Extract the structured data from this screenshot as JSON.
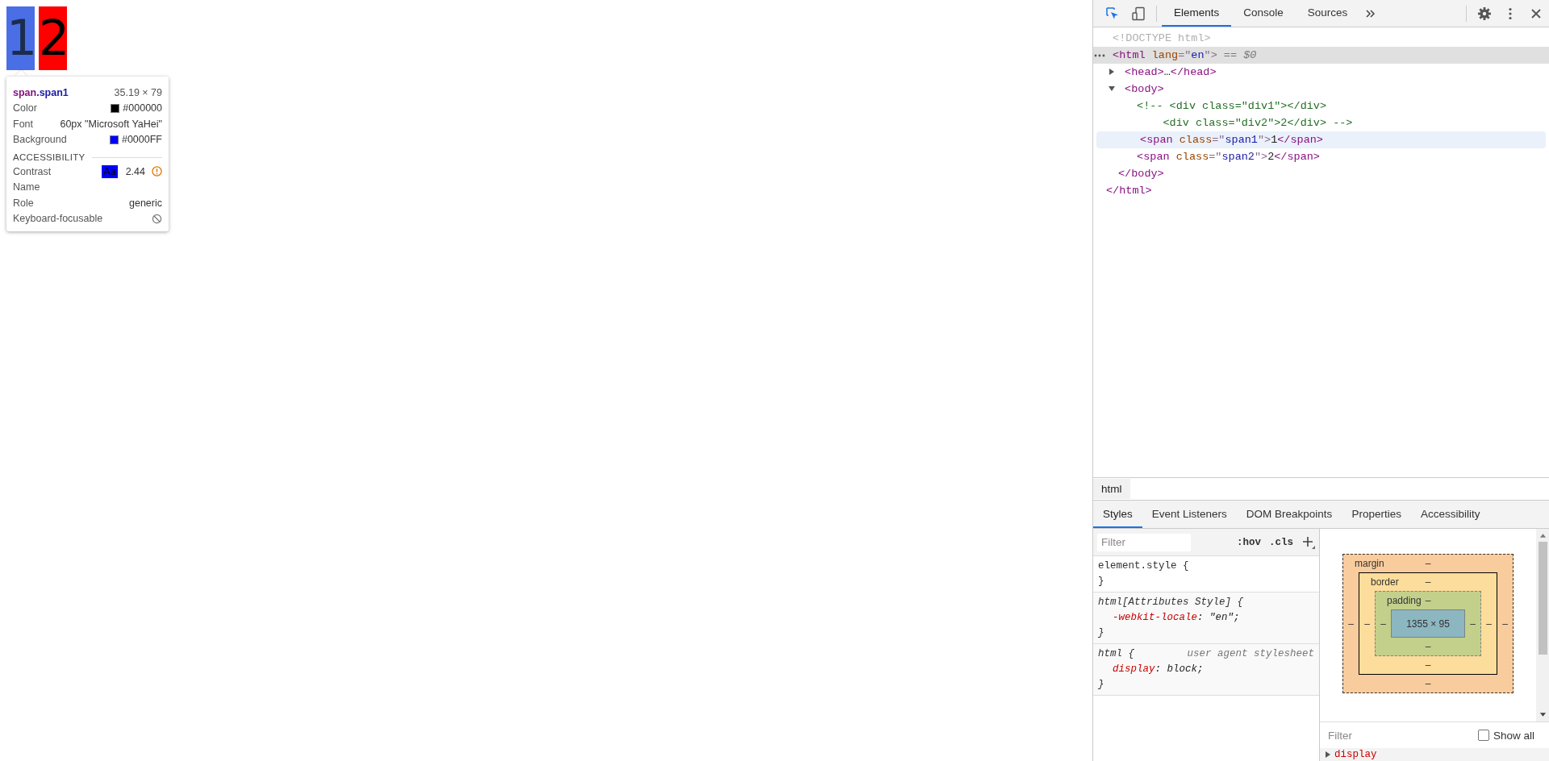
{
  "page": {
    "spans": [
      {
        "text": "1",
        "color": "#4a6ee6",
        "highlighted": true
      },
      {
        "text": "2",
        "color": "#ff0000",
        "highlighted": false
      }
    ]
  },
  "tooltip": {
    "tag": "span",
    "class_name": ".span1",
    "size": "35.19 × 79",
    "rows": [
      {
        "label": "Color",
        "value": "#000000",
        "color": "#000000"
      },
      {
        "label": "Font",
        "value": "60px \"Microsoft YaHei\""
      },
      {
        "label": "Background",
        "value": "#0000FF",
        "color": "#0000ff"
      }
    ],
    "section": "ACCESSIBILITY",
    "contrast": {
      "label": "Contrast",
      "sample": "Aa",
      "ratio": "2.44"
    },
    "a11y_rows": [
      {
        "label": "Name"
      },
      {
        "label": "Role",
        "value": "generic"
      },
      {
        "label": "Keyboard-focusable",
        "kind": "blocked"
      }
    ]
  },
  "devtools": {
    "tabs": [
      {
        "label": "Elements",
        "selected": true
      },
      {
        "label": "Console",
        "selected": false
      },
      {
        "label": "Sources",
        "selected": false
      }
    ],
    "dom": [
      {
        "lines": [
          [
            {
              "kind": "doctype",
              "text": "<!DOCTYPE html>"
            }
          ]
        ],
        "selected": false,
        "hovered": false
      },
      {
        "lines": [
          [
            {
              "kind": "tag",
              "text": "<html"
            },
            {
              "kind": "attr",
              "text": " lang"
            },
            {
              "kind": "punct",
              "text": "=\""
            },
            {
              "kind": "value",
              "text": "en"
            },
            {
              "kind": "punct",
              "text": "\">"
            },
            {
              "kind": "marker",
              "text": " == $0"
            }
          ]
        ],
        "selected": true,
        "hovered": false,
        "children": [
          {
            "lines": [
              [
                {
                  "kind": "tag",
                  "text": "<head>"
                },
                {
                  "kind": "text",
                  "text": "…"
                },
                {
                  "kind": "tag",
                  "text": "</head>"
                }
              ]
            ],
            "selected": false,
            "hovered": false,
            "expanded": false
          },
          {
            "lines": [
              [
                {
                  "kind": "tag",
                  "text": "<body>"
                }
              ]
            ],
            "selected": false,
            "hovered": false,
            "expanded": true,
            "children": [
              {
                "lines": [
                  [
                    {
                      "kind": "comment",
                      "text": "<!-- <div class=\"div1\"></div>"
                    }
                  ],
                  [
                    {
                      "kind": "comment",
                      "text": "    <div class=\"div2\">2</div> -->"
                    }
                  ]
                ],
                "selected": false,
                "hovered": false
              },
              {
                "lines": [
                  [
                    {
                      "kind": "tag",
                      "text": "<span"
                    },
                    {
                      "kind": "attr",
                      "text": " class"
                    },
                    {
                      "kind": "punct",
                      "text": "=\""
                    },
                    {
                      "kind": "value",
                      "text": "span1"
                    },
                    {
                      "kind": "punct",
                      "text": "\">"
                    },
                    {
                      "kind": "text",
                      "text": "1"
                    },
                    {
                      "kind": "tag",
                      "text": "</span>"
                    }
                  ]
                ],
                "selected": false,
                "hovered": true
              },
              {
                "lines": [
                  [
                    {
                      "kind": "tag",
                      "text": "<span"
                    },
                    {
                      "kind": "attr",
                      "text": " class"
                    },
                    {
                      "kind": "punct",
                      "text": "=\""
                    },
                    {
                      "kind": "value",
                      "text": "span2"
                    },
                    {
                      "kind": "punct",
                      "text": "\">"
                    },
                    {
                      "kind": "text",
                      "text": "2"
                    },
                    {
                      "kind": "tag",
                      "text": "</span>"
                    }
                  ]
                ],
                "selected": false,
                "hovered": false
              }
            ],
            "close": [
              {
                "kind": "tag",
                "text": "</body>"
              }
            ]
          }
        ],
        "close": [
          {
            "kind": "tag",
            "text": "</html>"
          }
        ]
      }
    ],
    "breadcrumb": "html",
    "subtabs": [
      {
        "label": "Styles",
        "selected": true
      },
      {
        "label": "Event Listeners",
        "selected": false
      },
      {
        "label": "DOM Breakpoints",
        "selected": false
      },
      {
        "label": "Properties",
        "selected": false
      },
      {
        "label": "Accessibility",
        "selected": false
      }
    ],
    "styles": {
      "filter_placeholder": "Filter",
      "hov": ":hov",
      "cls": ".cls",
      "rules": [
        {
          "kind": "inline",
          "selector": "element.style {",
          "close": "}"
        },
        {
          "kind": "attributes",
          "selector": "html[Attributes Style] {",
          "close": "}",
          "declarations": [
            {
              "property": "-webkit-locale",
              "rest": ": \"en\";"
            }
          ]
        },
        {
          "kind": "user-agent",
          "selector": "html {",
          "source": "user agent stylesheet",
          "close": "}",
          "declarations": [
            {
              "property": "display",
              "rest": ": block;"
            }
          ]
        }
      ]
    },
    "box_model": {
      "layers": [
        {
          "label": "margin",
          "top": "–"
        },
        {
          "label": "border",
          "top": "–"
        },
        {
          "label": "padding",
          "top": "–"
        }
      ],
      "middle_row": [
        "–",
        "–",
        "–",
        "1355 × 95",
        "–",
        "–",
        "–"
      ],
      "bottoms": [
        "–",
        "–",
        "–"
      ]
    },
    "computed": {
      "filter_placeholder": "Filter",
      "show_all": {
        "label": "Show all",
        "checked": false
      },
      "properties": [
        {
          "name": "display",
          "expanded": false
        }
      ]
    }
  }
}
